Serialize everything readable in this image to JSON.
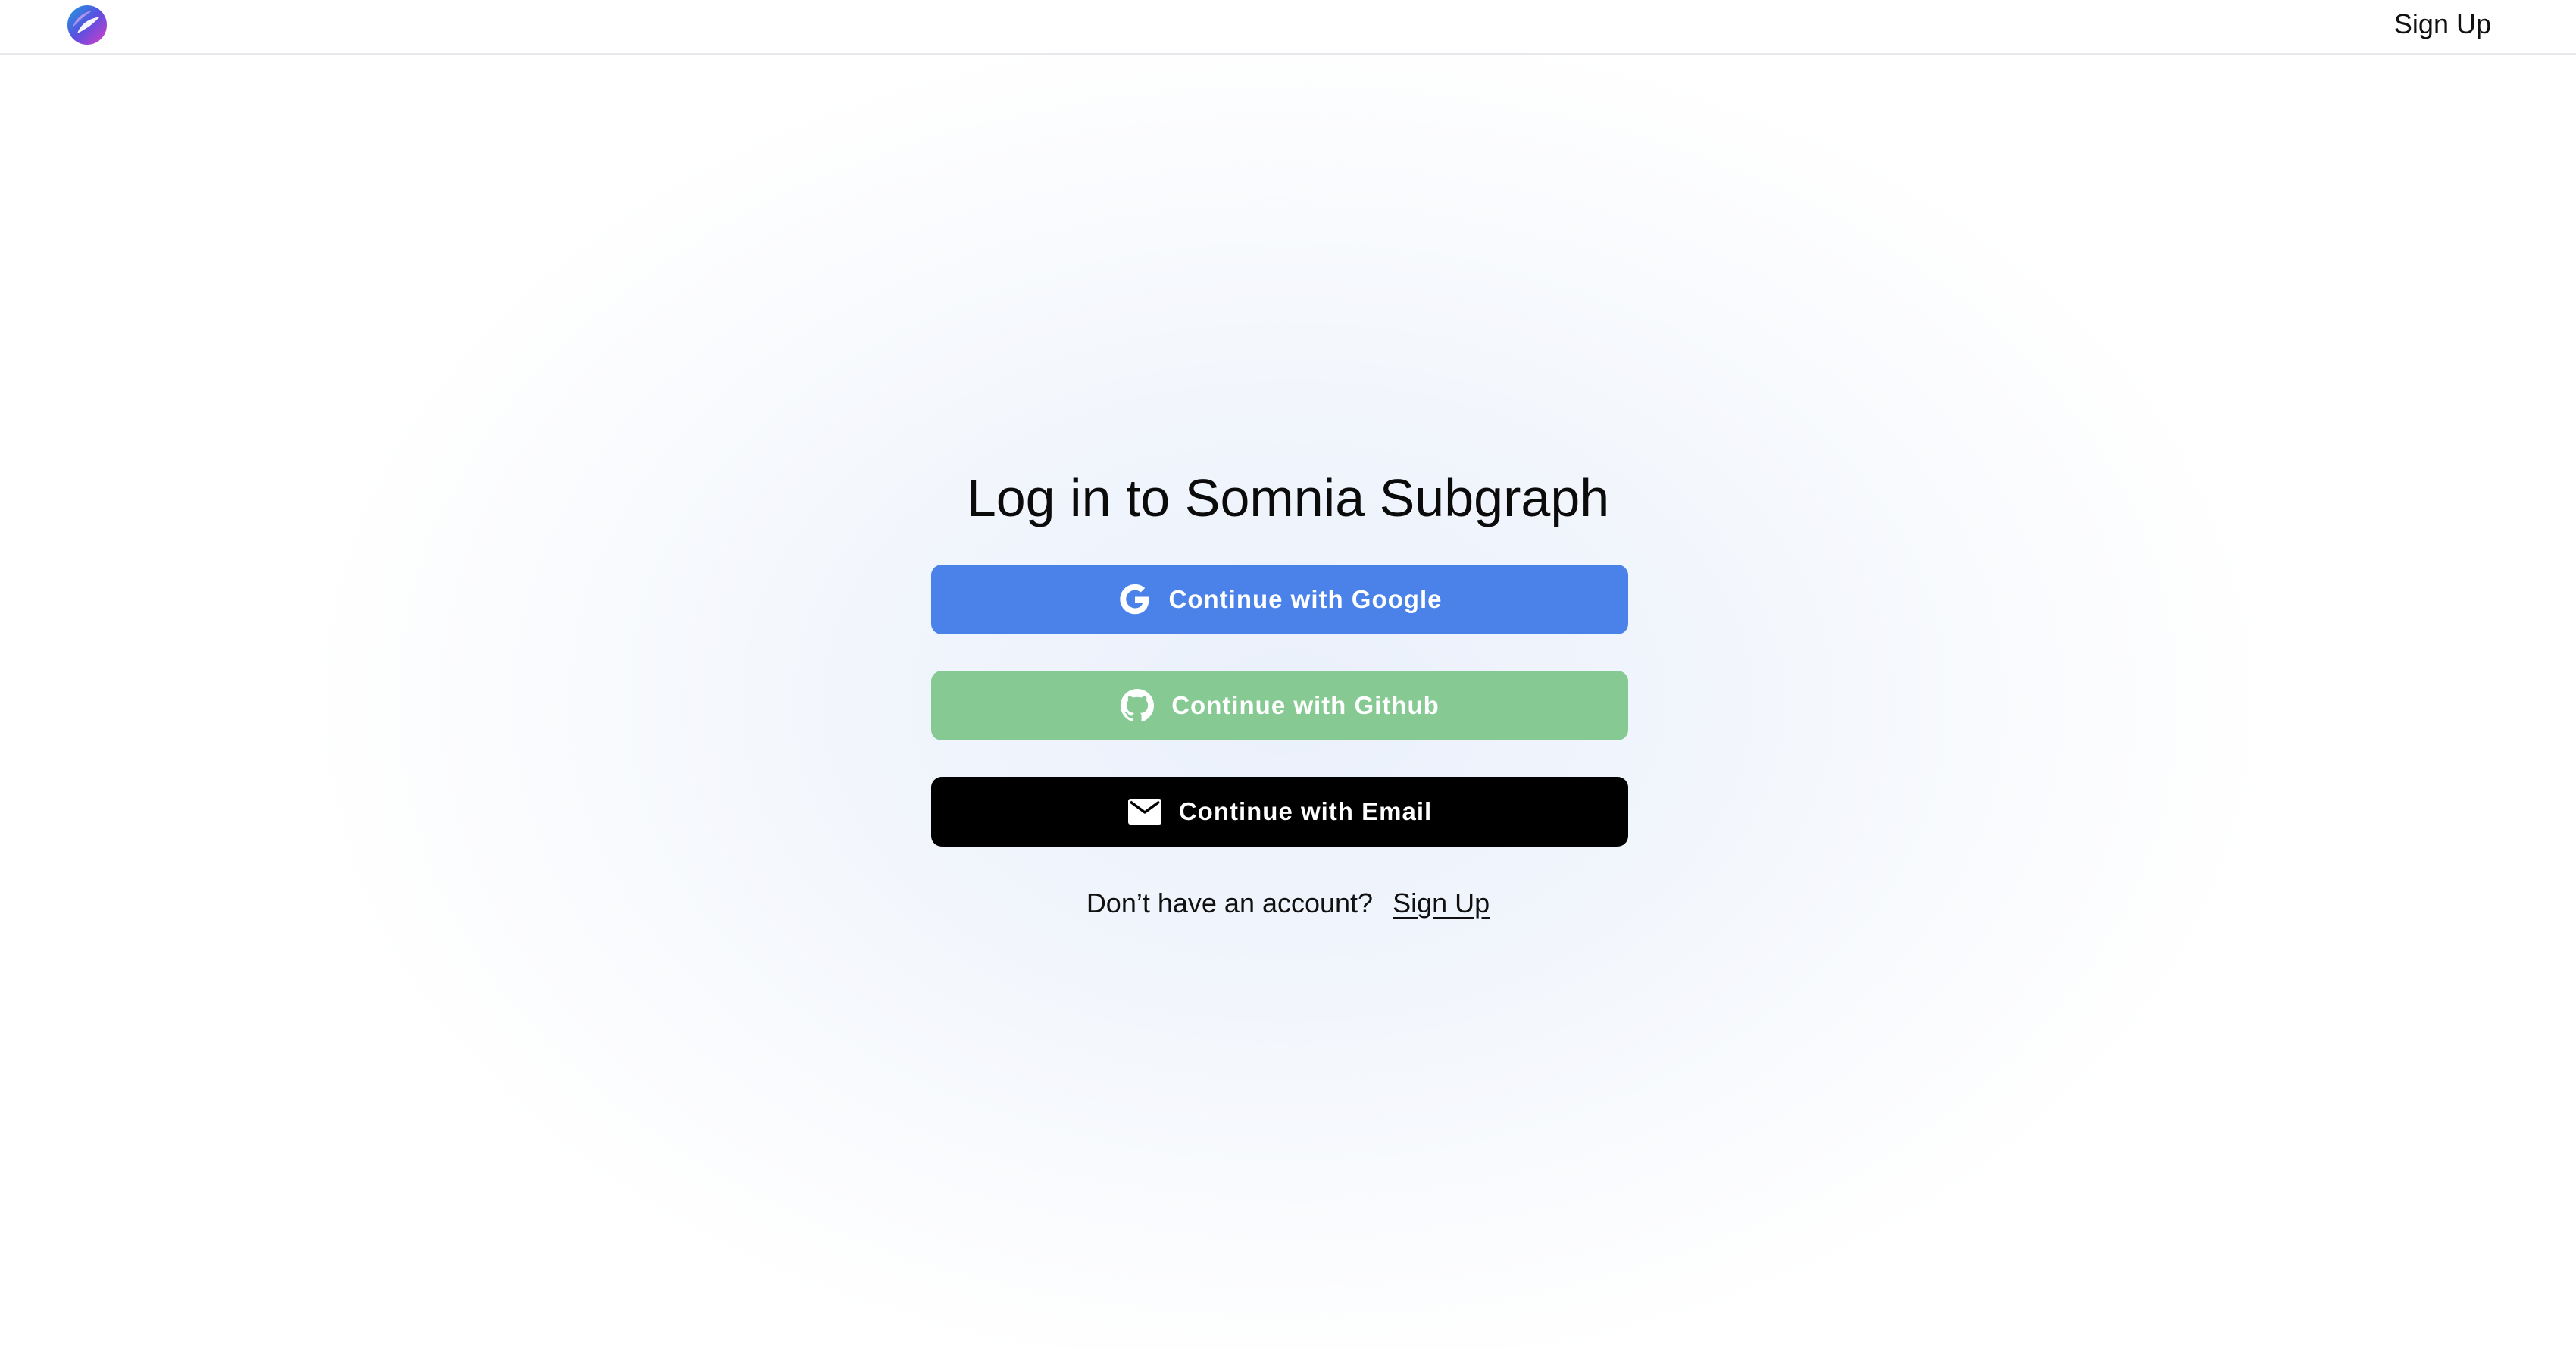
{
  "header": {
    "signup_label": "Sign Up"
  },
  "main": {
    "title": "Log in to Somnia Subgraph",
    "buttons": [
      {
        "label": "Continue with Google",
        "icon": "google-icon",
        "color": "#4a82ea"
      },
      {
        "label": "Continue with Github",
        "icon": "github-icon",
        "color": "#86c993"
      },
      {
        "label": "Continue with Email",
        "icon": "mail-icon",
        "color": "#000000"
      }
    ],
    "no_account_text": "Don’t have an account?",
    "signup_link": "Sign Up"
  },
  "colors": {
    "google": "#4a82ea",
    "github": "#86c993",
    "email": "#000000",
    "logo_top": "#2d7de0",
    "logo_bottom": "#c23bd0"
  }
}
